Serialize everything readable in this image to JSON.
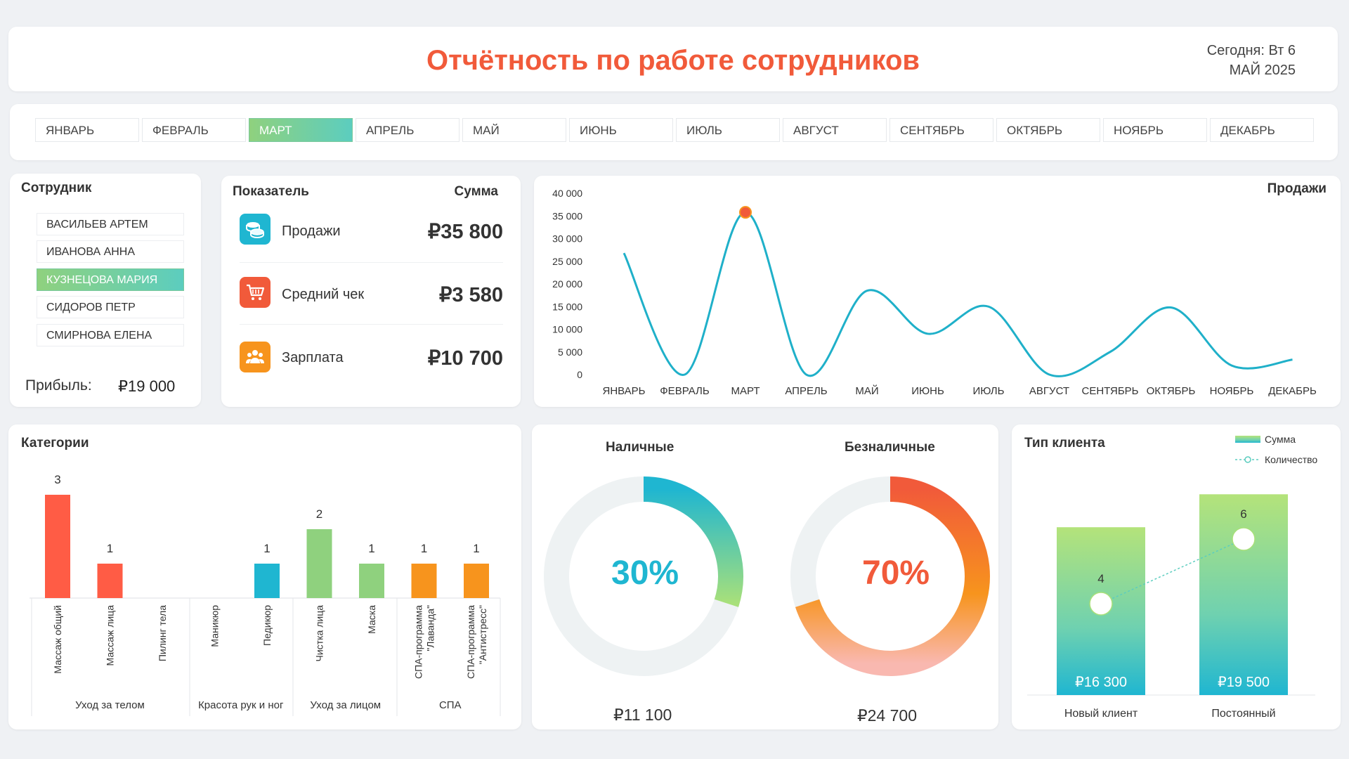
{
  "header": {
    "title": "Отчётность по работе сотрудников",
    "today_line1": "Сегодня: Вт 6",
    "today_line2": "МАЙ 2025"
  },
  "months": [
    "ЯНВАРЬ",
    "ФЕВРАЛЬ",
    "МАРТ",
    "АПРЕЛЬ",
    "МАЙ",
    "ИЮНЬ",
    "ИЮЛЬ",
    "АВГУСТ",
    "СЕНТЯБРЬ",
    "ОКТЯБРЬ",
    "НОЯБРЬ",
    "ДЕКАБРЬ"
  ],
  "selected_month": "МАРТ",
  "employees": {
    "title": "Сотрудник",
    "items": [
      "ВАСИЛЬЕВ АРТЕМ",
      "ИВАНОВА АННА",
      "КУЗНЕЦОВА МАРИЯ",
      "СИДОРОВ ПЕТР",
      "СМИРНОВА ЕЛЕНА"
    ],
    "selected": "КУЗНЕЦОВА МАРИЯ",
    "profit_label": "Прибыль:",
    "profit_value": "₽19 000"
  },
  "indicators": {
    "col_label": "Показатель",
    "col_sum": "Сумма",
    "rows": [
      {
        "label": "Продажи",
        "value": "₽35 800",
        "icon": "coins-icon",
        "color": "#1fb6d1"
      },
      {
        "label": "Средний чек",
        "value": "₽3 580",
        "icon": "cart-icon",
        "color": "#f15a3a"
      },
      {
        "label": "Зарплата",
        "value": "₽10 700",
        "icon": "team-icon",
        "color": "#f7941d"
      }
    ]
  },
  "colors": {
    "accent_red": "#f15a3a",
    "teal": "#1fb6d1",
    "green": "#8fd17e",
    "orange": "#f7941d"
  },
  "chart_data": [
    {
      "type": "line",
      "title": "Продажи",
      "categories": [
        "ЯНВАРЬ",
        "ФЕВРАЛЬ",
        "МАРТ",
        "АПРЕЛЬ",
        "МАЙ",
        "ИЮНЬ",
        "ИЮЛЬ",
        "АВГУСТ",
        "СЕНТЯБРЬ",
        "ОКТЯБРЬ",
        "НОЯБРЬ",
        "ДЕКАБРЬ"
      ],
      "values": [
        26800,
        0,
        35800,
        0,
        18500,
        9000,
        15000,
        0,
        5000,
        14800,
        2000,
        3300
      ],
      "highlight_index": 2,
      "yticks": [
        "0",
        "5 000",
        "10 000",
        "15 000",
        "20 000",
        "25 000",
        "30 000",
        "35 000",
        "40 000"
      ],
      "ylim": [
        0,
        40000
      ],
      "grid": false
    },
    {
      "type": "bar",
      "title": "Категории",
      "items": [
        {
          "label": "Массаж общий",
          "value": 3,
          "group": "Уход за телом",
          "color": "#ff5c45"
        },
        {
          "label": "Массаж лица",
          "value": 1,
          "group": "Уход за телом",
          "color": "#ff5c45"
        },
        {
          "label": "Пилинг тела",
          "value": 0,
          "group": "Уход за телом",
          "color": "#ff5c45"
        },
        {
          "label": "Маникюр",
          "value": 0,
          "group": "Красота рук и ног",
          "color": "#1fb6d1"
        },
        {
          "label": "Педикюр",
          "value": 1,
          "group": "Красота рук и ног",
          "color": "#1fb6d1"
        },
        {
          "label": "Чистка лица",
          "value": 2,
          "group": "Уход за лицом",
          "color": "#8fd17e"
        },
        {
          "label": "Маска",
          "value": 1,
          "group": "Уход за лицом",
          "color": "#8fd17e"
        },
        {
          "label": "СПА-программа \"Лаванда\"",
          "value": 1,
          "group": "СПА",
          "color": "#f7941d"
        },
        {
          "label": "СПА-программа \"Антистресс\"",
          "value": 1,
          "group": "СПА",
          "color": "#f7941d"
        }
      ],
      "groups": [
        "Уход за телом",
        "Красота рук и ног",
        "Уход за лицом",
        "СПА"
      ],
      "ylim": [
        0,
        3
      ]
    },
    {
      "type": "pie",
      "title": "Наличные",
      "percent_label": "30%",
      "fraction": 0.3,
      "sum": "₽11 100",
      "color": "#1fb6d1"
    },
    {
      "type": "pie",
      "title": "Безналичные",
      "percent_label": "70%",
      "fraction": 0.7,
      "sum": "₽24 700",
      "color": "#f15a3a"
    },
    {
      "type": "bar",
      "title": "Тип клиента",
      "categories": [
        "Новый клиент",
        "Постоянный"
      ],
      "series": [
        {
          "name": "Сумма",
          "values": [
            16300,
            19500
          ],
          "labels": [
            "₽16 300",
            "₽19 500"
          ]
        },
        {
          "name": "Количество",
          "values": [
            4,
            6
          ]
        }
      ]
    }
  ]
}
